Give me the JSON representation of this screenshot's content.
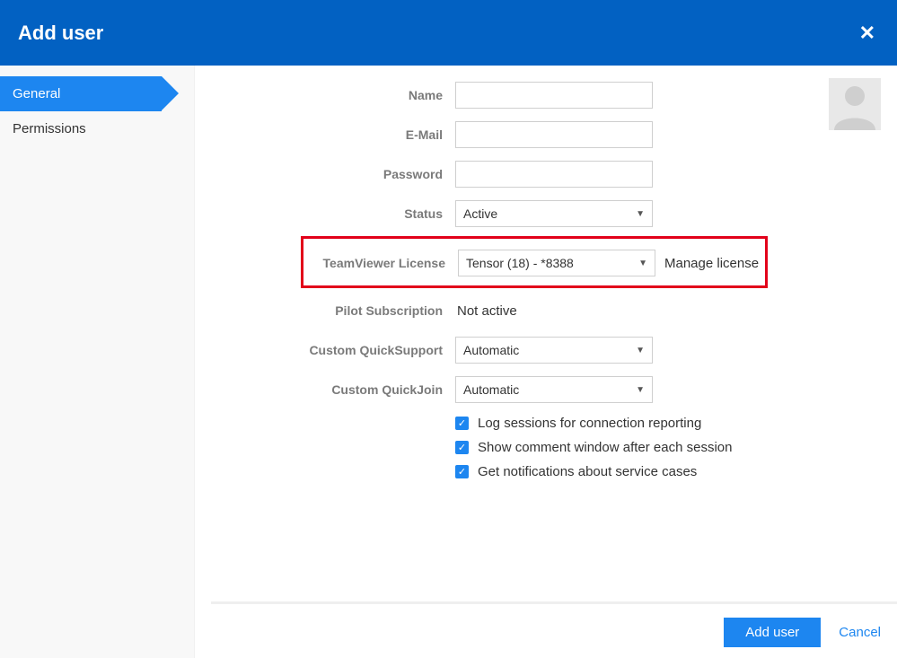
{
  "header": {
    "title": "Add user"
  },
  "sidebar": {
    "tabs": [
      {
        "label": "General",
        "active": true
      },
      {
        "label": "Permissions",
        "active": false
      }
    ]
  },
  "form": {
    "name": {
      "label": "Name",
      "value": ""
    },
    "email": {
      "label": "E-Mail",
      "value": ""
    },
    "password": {
      "label": "Password",
      "value": ""
    },
    "status": {
      "label": "Status",
      "value": "Active"
    },
    "license": {
      "label": "TeamViewer License",
      "value": "Tensor (18) - *8388",
      "manage": "Manage license"
    },
    "pilot": {
      "label": "Pilot Subscription",
      "value": "Not active"
    },
    "quicksupport": {
      "label": "Custom QuickSupport",
      "value": "Automatic"
    },
    "quickjoin": {
      "label": "Custom QuickJoin",
      "value": "Automatic"
    },
    "checks": {
      "log_sessions": {
        "label": "Log sessions for connection reporting",
        "checked": true
      },
      "show_comment": {
        "label": "Show comment window after each session",
        "checked": true
      },
      "notifications": {
        "label": "Get notifications about service cases",
        "checked": true
      }
    }
  },
  "footer": {
    "primary": "Add user",
    "cancel": "Cancel"
  }
}
